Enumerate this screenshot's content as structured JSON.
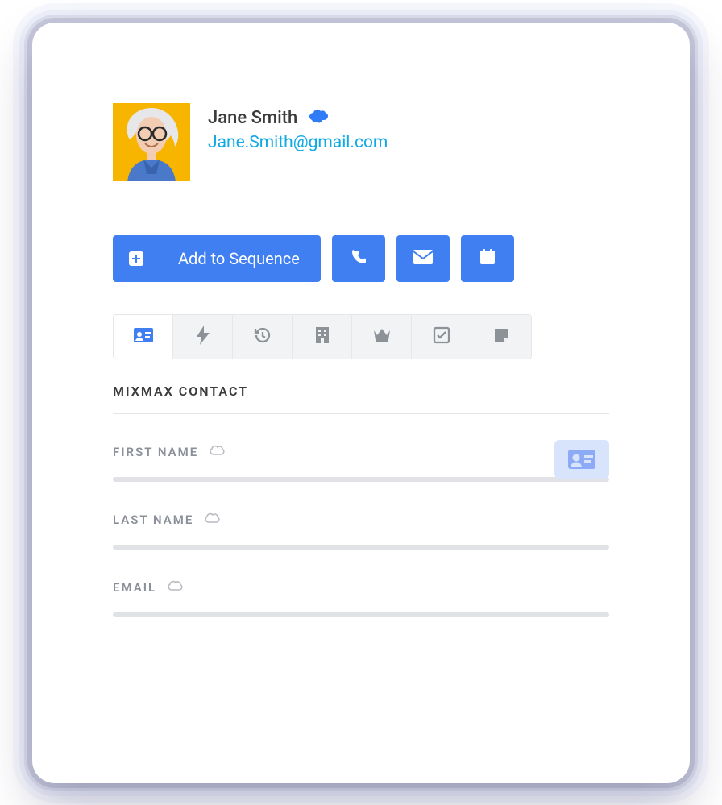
{
  "contact": {
    "name": "Jane Smith",
    "email": "Jane.Smith@gmail.com"
  },
  "actions": {
    "add_to_sequence_label": "Add to Sequence"
  },
  "section": {
    "title": "MIXMAX CONTACT"
  },
  "fields": {
    "first_name_label": "FIRST NAME",
    "last_name_label": "LAST NAME",
    "email_label": "EMAIL"
  }
}
